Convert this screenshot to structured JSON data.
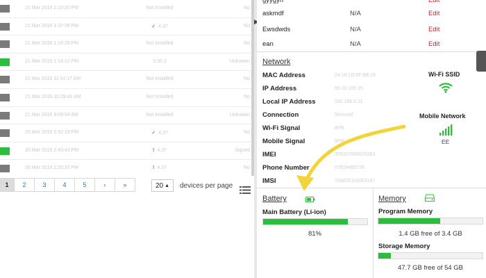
{
  "devices_table": {
    "rows": [
      {
        "swatch": "gray",
        "date": "21 Mar 2016 2:10:20 PM",
        "status": "Not Installed",
        "status_kind": "text",
        "right": "No"
      },
      {
        "swatch": "gray",
        "date": "21 Mar 2016 1:37:39 PM",
        "status": "4.37",
        "status_kind": "ok",
        "right": "No"
      },
      {
        "swatch": "gray",
        "date": "21 Mar 2016 1:16:29 PM",
        "status": "Not Installed",
        "status_kind": "text",
        "right": "No"
      },
      {
        "swatch": "green",
        "date": "21 Mar 2016 1:14:22 PM",
        "status": "3.35.2",
        "status_kind": "text",
        "right": "Unknown"
      },
      {
        "swatch": "gray",
        "date": "21 Mar 2016 11:41:17 AM",
        "status": "Not Installed",
        "status_kind": "text",
        "right": "No"
      },
      {
        "swatch": "gray",
        "date": "21 Mar 2016 10:28:41 AM",
        "status": "Not Installed",
        "status_kind": "text",
        "right": "No"
      },
      {
        "swatch": "gray",
        "date": "21 Mar 2016 9:09:04 AM",
        "status": "Not Installed",
        "status_kind": "text",
        "right": "Unknown"
      },
      {
        "swatch": "gray",
        "date": "20 Mar 2016 5:32:19 PM",
        "status": "4.37",
        "status_kind": "ok",
        "right": "No"
      },
      {
        "swatch": "green",
        "date": "20 Mar 2016 2:43:43 PM",
        "status": "4.37",
        "status_kind": "bad",
        "right": "Signed"
      },
      {
        "swatch": "gray",
        "date": "20 Mar 2016 2:20:32 PM",
        "status": "4.37",
        "status_kind": "bad",
        "right": "No"
      }
    ]
  },
  "pagination": {
    "pages": [
      "1",
      "2",
      "3",
      "4",
      "5",
      "›",
      "»"
    ],
    "active": "1",
    "per_page_value": "20",
    "per_page_label": "devices per page"
  },
  "custom_fields": [
    {
      "name": "gyygyn",
      "value": "",
      "action": "Edit"
    },
    {
      "name": "askmdf",
      "value": "N/A",
      "action": "Edit"
    },
    {
      "name": "Ewsdwds",
      "value": "N/A",
      "action": "Edit"
    },
    {
      "name": "ean",
      "value": "N/A",
      "action": "Edit"
    }
  ],
  "network": {
    "title": "Network",
    "fields": [
      {
        "label": "MAC Address",
        "value": "24:18:1D:6F:8B:10"
      },
      {
        "label": "IP Address",
        "value": "99.10.185.15"
      },
      {
        "label": "Local IP Address",
        "value": "192.168.0.11"
      },
      {
        "label": "Connection",
        "value": "Secured"
      },
      {
        "label": "Wi-Fi Signal",
        "value": "80%"
      },
      {
        "label": "Mobile Signal",
        "value": "95%"
      },
      {
        "label": "IMEI",
        "value": "355207068526353"
      },
      {
        "label": "Phone Number",
        "value": "07929465726"
      },
      {
        "label": "IMSI",
        "value": "234020101063167"
      }
    ],
    "wifi_ssid_label": "Wi-Fi SSID",
    "mobile_network_label": "Mobile Network",
    "carrier": "EE"
  },
  "battery": {
    "title": "Battery",
    "label": "Main Battery (Li-ion)",
    "level": 0.81,
    "percent_text": "81%"
  },
  "memory": {
    "title": "Memory",
    "program_label": "Program Memory",
    "program_used_fraction": 0.59,
    "program_text": "1.4 GB free of 3.4 GB",
    "storage_label": "Storage Memory",
    "storage_used_fraction": 0.12,
    "storage_text": "47.7 GB free of 54 GB"
  },
  "colors": {
    "accent_green": "#2dbd3c",
    "edit_red": "#d0202a",
    "link_blue": "#2a6fc0",
    "annotation_arrow": "#f2d33a"
  },
  "icons": {
    "wifi": "wifi-icon",
    "signal": "signal-bars-icon",
    "battery": "battery-icon",
    "memory": "drive-icon",
    "list": "list-icon"
  }
}
